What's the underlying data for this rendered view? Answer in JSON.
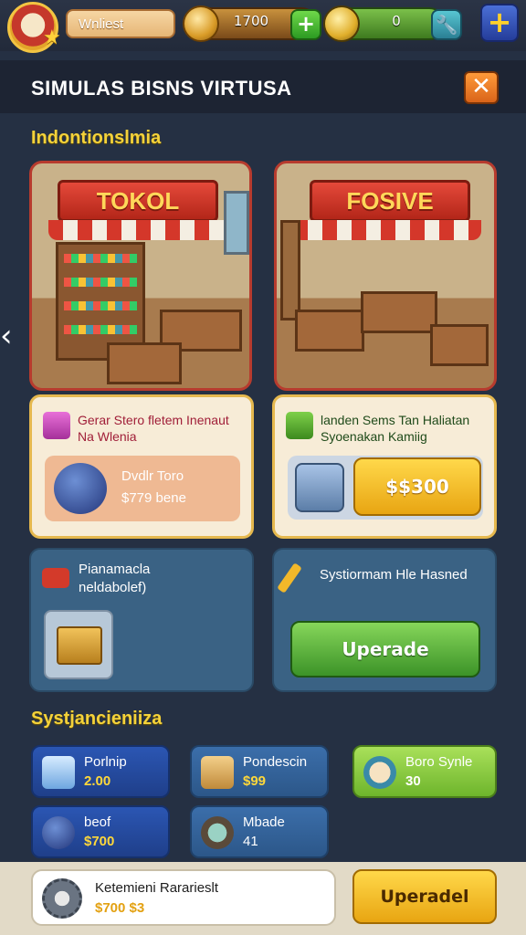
{
  "topbar": {
    "player_name": "Wnliest",
    "coins": "1700",
    "gems": "0"
  },
  "header": {
    "title": "SIMULAS BISNS  VIRTUSA"
  },
  "section1": {
    "title": "Indontionslmia"
  },
  "shops": [
    {
      "sign": "TOKOL"
    },
    {
      "sign": "FOSIVE"
    }
  ],
  "info_left": {
    "title": "Gerar Stero fletem Inenaut",
    "subtitle": "Na Wlenia",
    "item_name": "Dvdlr Toro",
    "item_price": "$779 bene"
  },
  "info_right": {
    "title": "landen Sems Tan Haliatan",
    "subtitle": "Syoenakan Kamiig",
    "price_button": "$$300"
  },
  "blue_left": {
    "line1": "Pianamacla",
    "line2": "neldabolef)"
  },
  "blue_right": {
    "text": "Systiormam Hle Hasned",
    "button": "Uperade"
  },
  "section2": {
    "title": "Systjancieniiza"
  },
  "tiles": [
    {
      "label": "Porlnip",
      "value": "2.00",
      "icon": "ice-cube-icon"
    },
    {
      "label": "Pondescin",
      "value": "$99",
      "icon": "card-icon"
    },
    {
      "label": "Boro Synle",
      "value": "30",
      "icon": "mascot-icon"
    },
    {
      "label": "beof",
      "value": "$700",
      "icon": "key-icon"
    },
    {
      "label": "Mbade",
      "value": "41",
      "icon": "plate-icon"
    }
  ],
  "bottom": {
    "label": "Ketemieni Rararieslt",
    "value": "$700 $3",
    "button": "Uperadel"
  },
  "colors": {
    "background": "#253043",
    "accent_yellow": "#f4d23a",
    "button_green": "#3c9328",
    "button_gold": "#e8a512",
    "shop_border": "#b73b2e"
  }
}
